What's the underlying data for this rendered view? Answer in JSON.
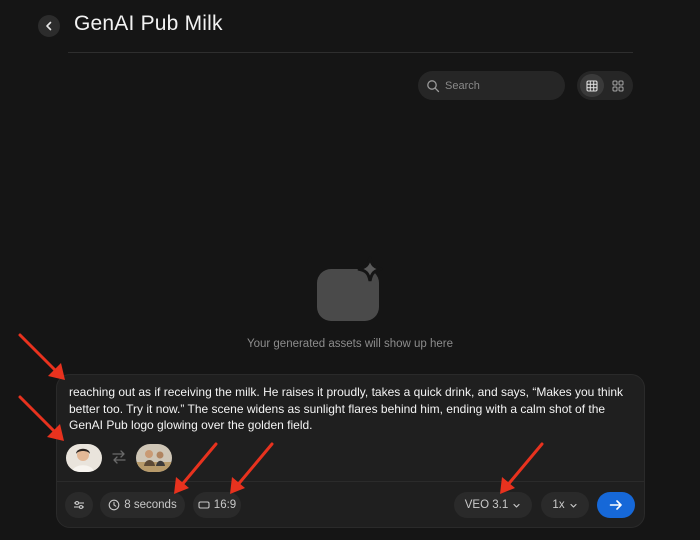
{
  "header": {
    "title": "GenAI Pub Milk"
  },
  "toolbar": {
    "search_placeholder": "Search"
  },
  "empty_state": {
    "message": "Your generated assets will show up here"
  },
  "composer": {
    "prompt": "reaching out as if receiving the milk. He raises it proudly, takes a quick drink, and says, “Makes you think better too. Try it now.” The scene widens as sunlight flares behind him, ending with a calm shot of the GenAI Pub logo glowing over the golden field.",
    "duration_label": "8 seconds",
    "aspect_ratio_label": "16:9",
    "model_label": "VEO 3.1",
    "speed_label": "1x"
  },
  "colors": {
    "background": "#151515",
    "accent": "#1668d8",
    "annotation_arrow": "#e8321e"
  }
}
